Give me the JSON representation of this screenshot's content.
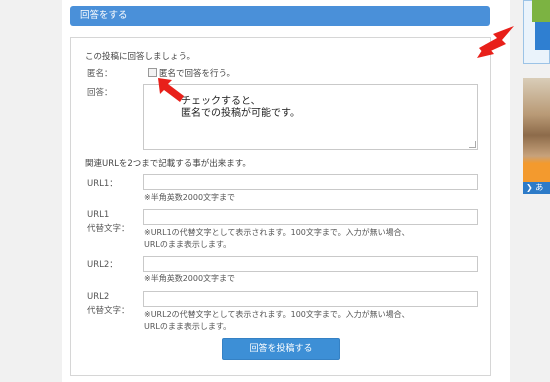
{
  "section": {
    "title": "回答をする"
  },
  "form": {
    "intro": "この投稿に回答しましょう。",
    "anonymous_label": "匿名：",
    "anonymous_checkbox_label": "匿名で回答を行う。",
    "answer_label": "回答：",
    "answer_overlay_line1": "チェックすると、",
    "answer_overlay_line2": "匿名での投稿が可能です。",
    "url_intro": "関連URLを2つまで記載する事が出来ます。",
    "url1_label": "URL1：",
    "url1_hint": "※半角英数2000文字まで",
    "url1_alt_label1": "URL1",
    "url1_alt_label2": "代替文字：",
    "url1_alt_hint1": "※URL1の代替文字として表示されます。100文字まで。入力が無い場合、",
    "url1_alt_hint2": "URLのまま表示します。",
    "url2_label": "URL2：",
    "url2_hint": "※半角英数2000文字まで",
    "url2_alt_label1": "URL2",
    "url2_alt_label2": "代替文字：",
    "url2_alt_hint1": "※URL2の代替文字として表示されます。100文字まで。入力が無い場合、",
    "url2_alt_hint2": "URLのまま表示します。",
    "submit_label": "回答を投稿する",
    "url1_value": "",
    "url1_alt_value": "",
    "url2_value": "",
    "url2_alt_value": ""
  },
  "sidebar": {
    "photo_caption": "❯ あ"
  },
  "colors": {
    "accent": "#4a90d9",
    "arrow": "#e8201a",
    "sidebar_green": "#7cb342",
    "sidebar_orange": "#f39a2e"
  },
  "icons": [
    "arrow-right-annotation-icon",
    "arrow-left-annotation-icon",
    "resize-grip-icon"
  ]
}
